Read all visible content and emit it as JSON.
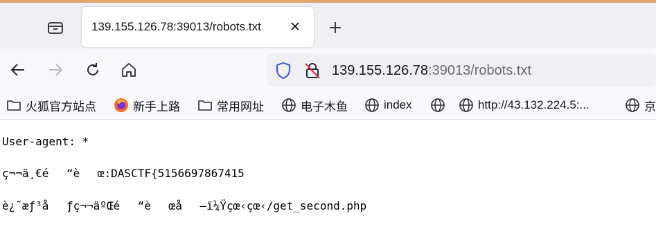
{
  "browser": {
    "tab": {
      "title": "139.155.126.78:39013/robots.txt"
    },
    "url": {
      "host": "139.155.126.78",
      "rest": ":39013/robots.txt"
    },
    "colors": {
      "accent": "#e0a66b",
      "tabstrip": "#f0f0f4",
      "toolbar": "#f9f9fb",
      "shield": "#4a5bd1",
      "lock_slash": "#e22850"
    }
  },
  "bookmarks": [
    {
      "label": "火狐官方站点",
      "icon": "folder-icon"
    },
    {
      "label": "新手上路",
      "icon": "firefox-icon"
    },
    {
      "label": "常用网址",
      "icon": "folder-icon"
    },
    {
      "label": "电子木鱼",
      "icon": "globe-icon"
    },
    {
      "label": "index",
      "icon": "globe-icon"
    },
    {
      "label": "",
      "icon": "globe-icon"
    },
    {
      "label": "http://43.132.224.5:...",
      "icon": "globe-icon"
    },
    {
      "label": "京",
      "icon": "globe-icon"
    }
  ],
  "document": {
    "lines": [
      "User-agent: *",
      "ç¬¬ä¸€é“èœ:DASCTF{5156697867415",
      "è¿˜æƒ³åƒç¬¬äºŒé“èœå–ï¼Ÿçœ‹çœ‹/get_second.php"
    ]
  }
}
